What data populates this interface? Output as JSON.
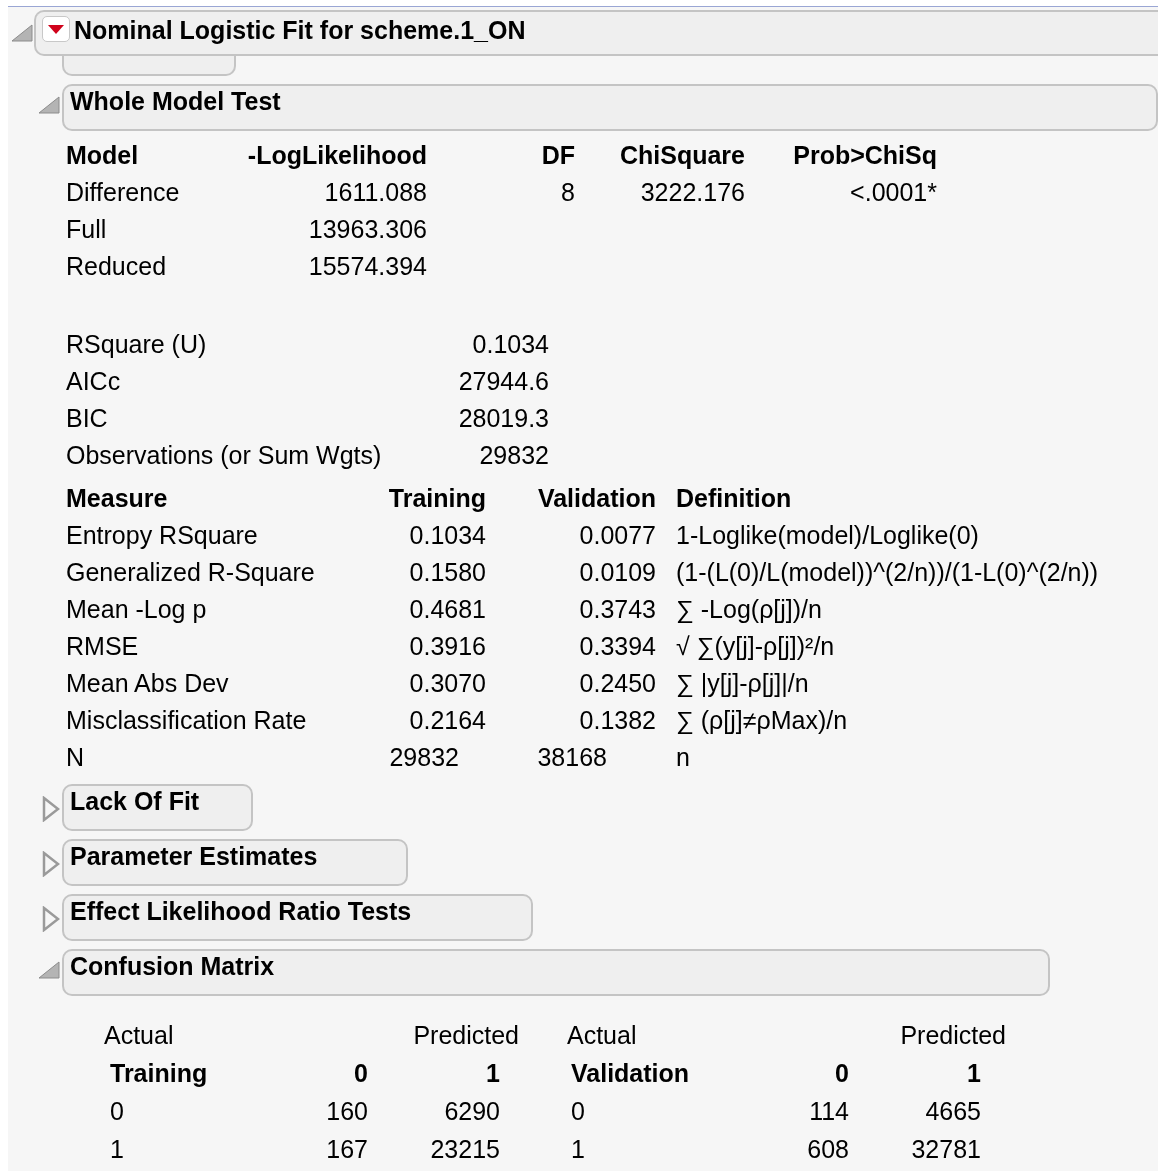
{
  "report": {
    "title": "Nominal Logistic Fit for scheme.1_ON",
    "expanded": true
  },
  "sections": [
    {
      "kind": "whole_model",
      "title": "Whole Model Test",
      "expanded": true,
      "model_table": {
        "columns": [
          "Model",
          "-LogLikelihood",
          "DF",
          "ChiSquare",
          "Prob>ChiSq"
        ],
        "rows": [
          [
            "Difference",
            "1611.088",
            "8",
            "3222.176",
            "<.0001*"
          ],
          [
            "Full",
            "13963.306",
            "",
            "",
            ""
          ],
          [
            "Reduced",
            "15574.394",
            "",
            "",
            ""
          ]
        ]
      },
      "fit_stats": [
        {
          "label": "RSquare (U)",
          "value": "0.1034"
        },
        {
          "label": "AICc",
          "value": "27944.6"
        },
        {
          "label": "BIC",
          "value": "28019.3"
        },
        {
          "label": "Observations (or Sum Wgts)",
          "value": "29832"
        }
      ],
      "measure_table": {
        "columns": [
          "Measure",
          "Training",
          "Validation",
          "Definition"
        ],
        "rows": [
          {
            "kind": "fraction",
            "cells": [
              "Entropy RSquare",
              "0.1034",
              "0.0077",
              "1-Loglike(model)/Loglike(0)"
            ]
          },
          {
            "kind": "fraction",
            "cells": [
              "Generalized R-Square",
              "0.1580",
              "0.0109",
              "(1-(L(0)/L(model))^(2/n))/(1-L(0)^(2/n))"
            ]
          },
          {
            "kind": "fraction",
            "cells": [
              "Mean -Log p",
              "0.4681",
              "0.3743",
              "∑ -Log(ρ[j])/n"
            ]
          },
          {
            "kind": "fraction",
            "cells": [
              "RMSE",
              "0.3916",
              "0.3394",
              "√ ∑(y[j]-ρ[j])²/n"
            ]
          },
          {
            "kind": "fraction",
            "cells": [
              "Mean Abs Dev",
              "0.3070",
              "0.2450",
              "∑ |y[j]-ρ[j]|/n"
            ]
          },
          {
            "kind": "fraction",
            "cells": [
              "Misclassification Rate",
              "0.2164",
              "0.1382",
              "∑ (ρ[j]≠ρMax)/n"
            ]
          },
          {
            "kind": "count",
            "cells": [
              "N",
              "29832",
              "38168",
              "n"
            ]
          }
        ]
      }
    },
    {
      "title": "Lack Of Fit",
      "expanded": false
    },
    {
      "title": "Parameter Estimates",
      "expanded": false
    },
    {
      "title": "Effect Likelihood Ratio Tests",
      "expanded": false
    },
    {
      "kind": "confusion",
      "title": "Confusion Matrix",
      "expanded": true,
      "matrices": [
        {
          "actual_label": "Actual",
          "predicted_label": "Predicted",
          "columns": [
            "Training",
            "0",
            "1"
          ],
          "rows": [
            [
              "0",
              "160",
              "6290"
            ],
            [
              "1",
              "167",
              "23215"
            ]
          ]
        },
        {
          "actual_label": "Actual",
          "predicted_label": "Predicted",
          "columns": [
            "Validation",
            "0",
            "1"
          ],
          "rows": [
            [
              "0",
              "114",
              "4665"
            ],
            [
              "1",
              "608",
              "32781"
            ]
          ]
        }
      ]
    }
  ]
}
